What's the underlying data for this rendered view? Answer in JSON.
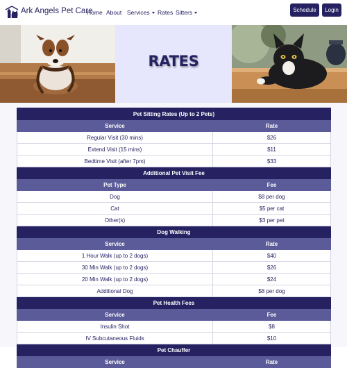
{
  "brand": {
    "name": "Ark Angels Pet Care",
    "logo_icon": "dog-and-cat-silhouette-icon"
  },
  "nav": {
    "items": [
      {
        "label": "Home",
        "dropdown": false
      },
      {
        "label": "About",
        "dropdown": false
      },
      {
        "label": "Services",
        "dropdown": true
      },
      {
        "label": "Rates",
        "dropdown": false
      },
      {
        "label": "Sitters",
        "dropdown": true
      }
    ],
    "schedule_label": "Schedule",
    "login_label": "Login"
  },
  "hero": {
    "title": "RATES"
  },
  "colors": {
    "primary": "#262262",
    "column_header": "#5c5b99",
    "hero_bg": "#e6e6fc"
  },
  "sections": [
    {
      "title": "Pet Sitting Rates (Up to 2 Pets)",
      "columns": [
        "Service",
        "Rate"
      ],
      "rows": [
        [
          "Regular Visit (30 mins)",
          "$26"
        ],
        [
          "Extend Visit (15 mins)",
          "$11"
        ],
        [
          "Bedtime Visit (after 7pm)",
          "$33"
        ]
      ]
    },
    {
      "title": "Additional Pet Visit Fee",
      "columns": [
        "Pet Type",
        "Fee"
      ],
      "rows": [
        [
          "Dog",
          "$8 per dog"
        ],
        [
          "Cat",
          "$5 per cat"
        ],
        [
          "Other(s)",
          "$3 per pet"
        ]
      ]
    },
    {
      "title": "Dog Walking",
      "columns": [
        "Service",
        "Rate"
      ],
      "rows": [
        [
          "1 Hour Walk (up to 2 dogs)",
          "$40"
        ],
        [
          "30 Min Walk (up to 2 dogs)",
          "$26"
        ],
        [
          "20 Min Walk (up to 2 dogs)",
          "$24"
        ],
        [
          "Additional Dog",
          "$8 per dog"
        ]
      ]
    },
    {
      "title": "Pet Health Fees",
      "columns": [
        "Service",
        "Fee"
      ],
      "rows": [
        [
          "Insulin Shot",
          "$8"
        ],
        [
          "IV Subcutaneous Fluids",
          "$10"
        ]
      ]
    },
    {
      "title": "Pet Chauffer",
      "columns": [
        "Service",
        "Rate"
      ],
      "rows": []
    }
  ]
}
